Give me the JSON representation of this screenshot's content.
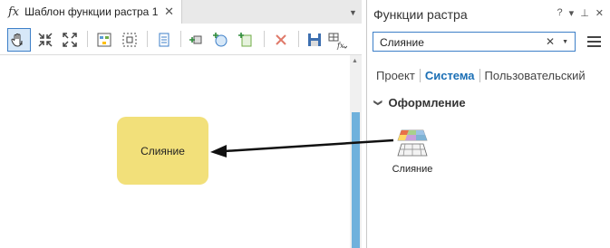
{
  "document_tab": {
    "icon_text": "fx",
    "title": "Шаблон функции растра 1",
    "close": "✕",
    "menu": "▼"
  },
  "toolbar": {
    "tools": [
      "pan-tool",
      "fit-tool",
      "full-extent-tool",
      "auto-layout-tool",
      "select-tool",
      "properties-tool",
      "add-function-tool",
      "add-raster-tool",
      "add-variable-tool",
      "delete-tool",
      "save-tool",
      "function-tool"
    ]
  },
  "canvas": {
    "node_label": "Слияние"
  },
  "panel": {
    "title": "Функции растра",
    "controls": {
      "help": "?",
      "menu": "▾",
      "pin": "⊥",
      "close": "✕"
    },
    "search": {
      "value": "Слияние",
      "clear": "✕",
      "drop": "▼"
    },
    "tabs": [
      "Проект",
      "Система",
      "Пользовательский"
    ],
    "active_tab": "Система",
    "section": {
      "chevron": "❯",
      "label": "Оформление"
    },
    "function_item": {
      "label": "Слияние"
    }
  },
  "colors": {
    "accent": "#1b6fb5",
    "node": "#f2e07a",
    "scroll_thumb": "#6fb1dc"
  }
}
